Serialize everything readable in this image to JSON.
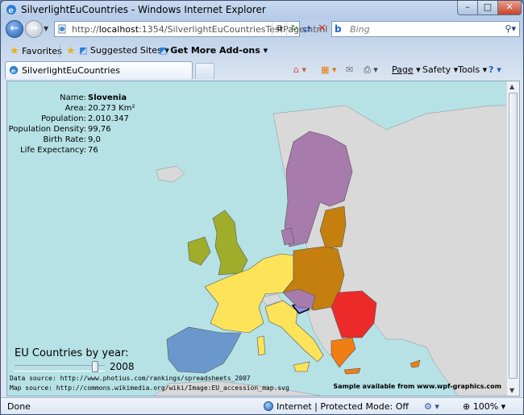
{
  "window": {
    "title": "SilverlightEuCountries - Windows Internet Explorer"
  },
  "address": {
    "url_prefix": "http://",
    "url_host": "localhost",
    "url_rest": ":1354/SilverlightEuCountriesTestPage.html"
  },
  "search": {
    "placeholder": "Bing"
  },
  "favorites_bar": {
    "favorites": "Favorites",
    "suggested": "Suggested Sites",
    "addons": "Get More Add-ons"
  },
  "tab": {
    "label": "SilverlightEuCountries"
  },
  "commandbar": {
    "page": "Page",
    "safety": "Safety",
    "tools": "Tools"
  },
  "info": {
    "rows": [
      {
        "label": "Name:",
        "value": "Slovenia"
      },
      {
        "label": "Area:",
        "value": "20.273 Km²"
      },
      {
        "label": "Population:",
        "value": "2.010.347"
      },
      {
        "label": "Population Density:",
        "value": "99,76"
      },
      {
        "label": "Birth Rate:",
        "value": "9,0"
      },
      {
        "label": "Life Expectancy:",
        "value": "76"
      }
    ]
  },
  "year_control": {
    "title": "EU Countries by year:",
    "year": "2008",
    "slider_position": 0.92
  },
  "sources": {
    "data": "Data source: http://www.photius.com/rankings/spreadsheets_2007",
    "map": "Map source: http://commons.wikimedia.org/wiki/Image:EU_accession_map.svg",
    "sample": "Sample available from www.wpf-graphics.com"
  },
  "status": {
    "left": "Done",
    "zone": "Internet | Protected Mode: Off",
    "zoom": "100%"
  },
  "colors": {
    "sea": "#b6e2e6",
    "land": "#d9d9d9",
    "uk_ireland": "#9fad2b",
    "france_benelux": "#fde35a",
    "scandinavia": "#a77bab",
    "central": "#c47f0e",
    "baltics": "#c47f0e",
    "iberia": "#6b98cc",
    "romania_bulgaria": "#ec2a2a",
    "greece": "#f07e12",
    "slovenia": "#8f8fe8"
  }
}
